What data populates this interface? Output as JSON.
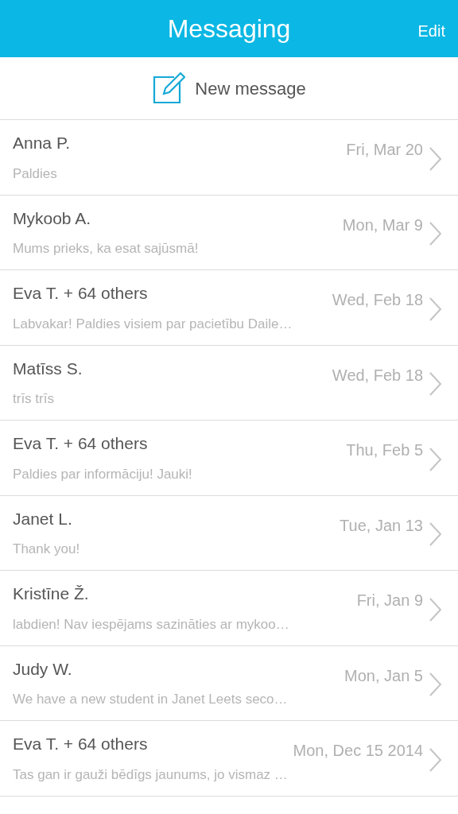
{
  "header": {
    "title": "Messaging",
    "edit": "Edit"
  },
  "new_message": {
    "label": "New message"
  },
  "conversations": [
    {
      "name": "Anna P.",
      "date": "Fri, Mar 20",
      "preview": "Paldies"
    },
    {
      "name": "Mykoob A.",
      "date": "Mon, Mar 9",
      "preview": "Mums prieks, ka esat sajūsmā!"
    },
    {
      "name": "Eva T. + 64 others",
      "date": "Wed, Feb 18",
      "preview": "Labvakar! Paldies visiem par pacietību Daile…"
    },
    {
      "name": "Matīss S.",
      "date": "Wed, Feb 18",
      "preview": "trīs trīs"
    },
    {
      "name": "Eva T. + 64 others",
      "date": "Thu, Feb 5",
      "preview": "Paldies par informāciju! Jauki!"
    },
    {
      "name": "Janet L.",
      "date": "Tue, Jan 13",
      "preview": "Thank you!"
    },
    {
      "name": "Kristīne Ž.",
      "date": "Fri, Jan 9",
      "preview": "labdien! Nav iespējams sazināties ar mykoo…"
    },
    {
      "name": "Judy W.",
      "date": "Mon, Jan 5",
      "preview": "We have a new student in Janet Leets seco…"
    },
    {
      "name": "Eva T. + 64 others",
      "date": "Mon, Dec 15 2014",
      "preview": "Tas gan ir gauži bēdīgs jaunums, jo vismaz …"
    }
  ]
}
